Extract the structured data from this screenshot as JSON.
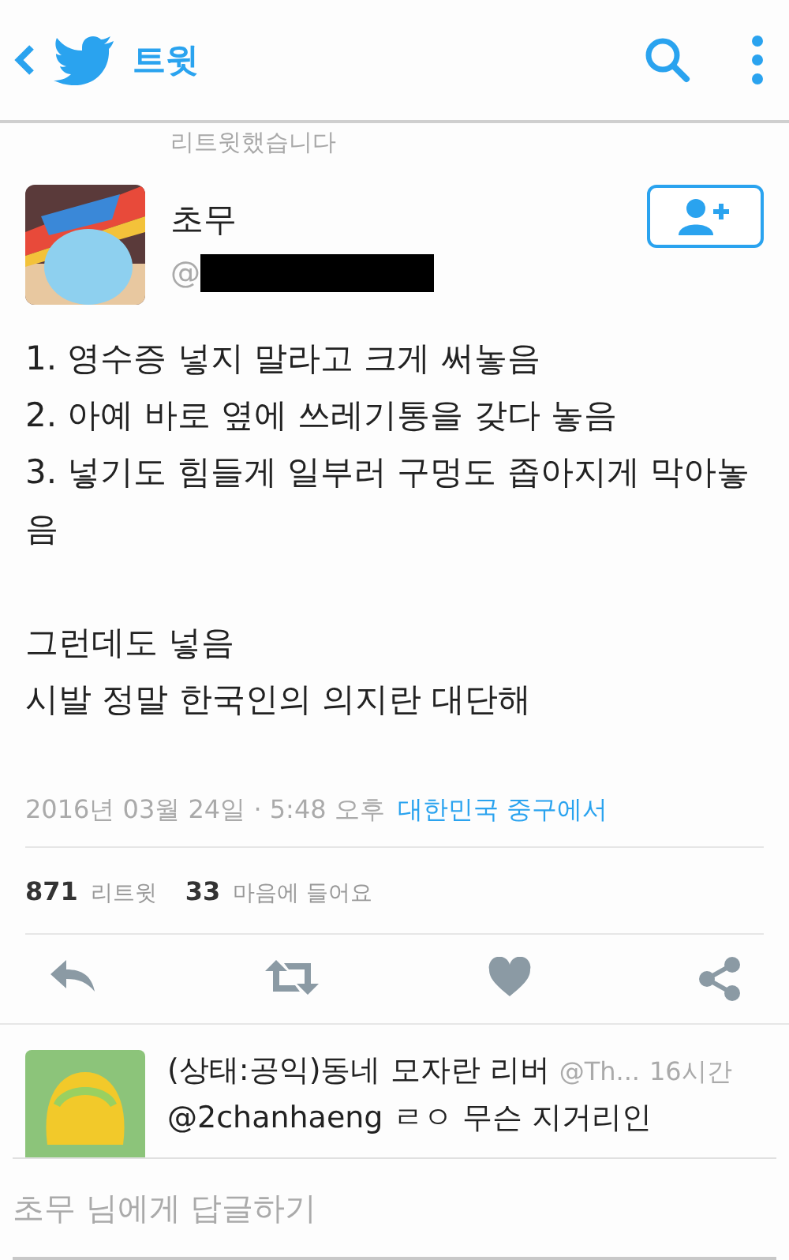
{
  "header": {
    "title": "트윗"
  },
  "retweet_note": "리트윗했습니다",
  "author": {
    "name": "초무",
    "handle": "@"
  },
  "tweet": {
    "paragraphs": [
      [
        "1. 영수증 넣지 말라고 크게 써놓음",
        "2. 아예 바로 옆에 쓰레기통을 갖다 놓음",
        "3. 넣기도 힘들게 일부러 구멍도 좁아지게 막아놓음"
      ],
      [
        "그런데도 넣음",
        "시발 정말 한국인의 의지란 대단해"
      ]
    ],
    "date": "2016년 03월 24일 · 5:48 오후",
    "location": "대한민국 중구에서"
  },
  "stats": [
    {
      "count": "871",
      "label": "리트윗"
    },
    {
      "count": "33",
      "label": "마음에 들어요"
    }
  ],
  "actions": [
    {
      "kind": "reply"
    },
    {
      "kind": "retweet"
    },
    {
      "kind": "like"
    },
    {
      "kind": "share"
    }
  ],
  "replies": [
    {
      "name": "(상태:공익)동네 모자란 리버",
      "handle": "@Th...",
      "time": "16시간",
      "text": "@2chanhaeng ㄹㅇ 무슨 지거리인"
    }
  ],
  "reply_box": {
    "placeholder": "초무 님에게 답글하기"
  }
}
